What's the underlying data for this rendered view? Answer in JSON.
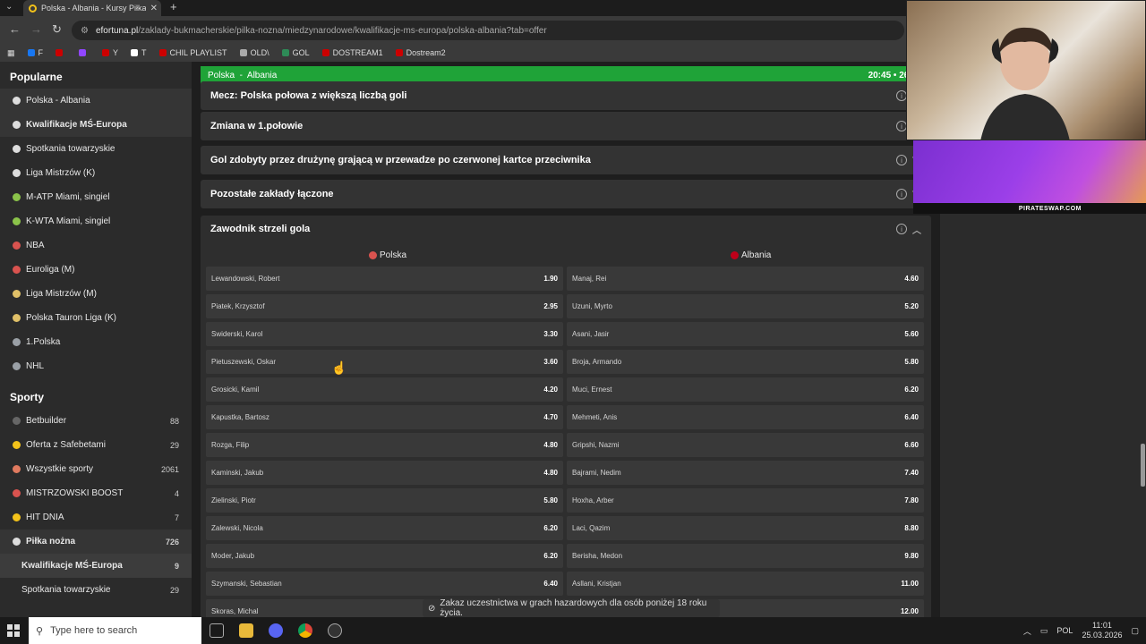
{
  "browser": {
    "tab_title": "Polska - Albania - Kursy Piłka n",
    "url_domain": "efortuna.pl",
    "url_path": "/zaklady-bukmacherskie/pilka-nozna/miedzynarodowe/kwalifikacje-ms-europa/polska-albania?tab=offer",
    "bookmarks": [
      {
        "label": "F",
        "color": "#1877f2"
      },
      {
        "label": "",
        "color": "#cc0000"
      },
      {
        "label": "",
        "color": "#9146ff"
      },
      {
        "label": "Y",
        "color": "#cc0000"
      },
      {
        "label": "T",
        "color": "#ffffff"
      },
      {
        "label": "CHIL PLAYLIST",
        "color": "#cc0000"
      },
      {
        "label": "OLD\\",
        "color": "#aaaaaa"
      },
      {
        "label": "GOL",
        "color": "#2e8b57"
      },
      {
        "label": "DOSTREAM1",
        "color": "#cc0000"
      },
      {
        "label": "Dostream2",
        "color": "#cc0000"
      }
    ]
  },
  "sidebar": {
    "popular_title": "Popularne",
    "popular": [
      {
        "label": "Polska - Albania",
        "icon": "soccer-ball-icon",
        "color": "#dddddd",
        "style": "hl"
      },
      {
        "label": "Kwalifikacje MŚ-Europa",
        "icon": "soccer-ball-icon",
        "color": "#dddddd",
        "style": "hlb"
      },
      {
        "label": "Spotkania towarzyskie",
        "icon": "soccer-ball-icon",
        "color": "#dddddd",
        "style": ""
      },
      {
        "label": "Liga Mistrzów (K)",
        "icon": "soccer-ball-icon",
        "color": "#dddddd",
        "style": ""
      },
      {
        "label": "M-ATP Miami, singiel",
        "icon": "tennis-ball-icon",
        "color": "#8bc34a",
        "style": ""
      },
      {
        "label": "K-WTA Miami, singiel",
        "icon": "tennis-ball-icon",
        "color": "#8bc34a",
        "style": ""
      },
      {
        "label": "NBA",
        "icon": "basketball-icon",
        "color": "#d9534f",
        "style": ""
      },
      {
        "label": "Euroliga (M)",
        "icon": "basketball-icon",
        "color": "#d9534f",
        "style": ""
      },
      {
        "label": "Liga Mistrzów (M)",
        "icon": "volleyball-icon",
        "color": "#e0c068",
        "style": ""
      },
      {
        "label": "Polska Tauron Liga (K)",
        "icon": "volleyball-icon",
        "color": "#e0c068",
        "style": ""
      },
      {
        "label": "1.Polska",
        "icon": "hockey-stick-icon",
        "color": "#9aa0a6",
        "style": ""
      },
      {
        "label": "NHL",
        "icon": "hockey-stick-icon",
        "color": "#9aa0a6",
        "style": ""
      }
    ],
    "sports_title": "Sporty",
    "sports": [
      {
        "label": "Betbuilder",
        "count": "88",
        "icon": "betbuilder-icon",
        "color": "#666666"
      },
      {
        "label": "Oferta z Safebetami",
        "count": "29",
        "icon": "safebet-icon",
        "color": "#f3c21a"
      },
      {
        "label": "Wszystkie sporty",
        "count": "2061",
        "icon": "all-sports-icon",
        "color": "#e07a5f"
      },
      {
        "label": "MISTRZOWSKI BOOST",
        "count": "4",
        "icon": "boost-icon",
        "color": "#d9534f"
      },
      {
        "label": "HIT DNIA",
        "count": "7",
        "icon": "hit-icon",
        "color": "#f3c21a"
      },
      {
        "label": "Piłka nożna",
        "count": "726",
        "icon": "soccer-ball-icon",
        "color": "#dddddd"
      }
    ],
    "subitems": [
      {
        "label": "Kwalifikacje MŚ-Europa",
        "count": "9",
        "active": true
      },
      {
        "label": "Spotkania towarzyskie",
        "count": "29",
        "active": false
      }
    ]
  },
  "match": {
    "header": "Polska  -  Albania",
    "time": "20:45  •  26.03."
  },
  "markets": [
    {
      "label": "Mecz: Polska połowa z większą liczbą goli"
    },
    {
      "label": "Zmiana w 1.połowie"
    },
    {
      "label": "Gol zdobyty przez drużynę grającą w przewadze po czerwonej kartce przeciwnika"
    },
    {
      "label": "Pozostałe zakłady łączone"
    }
  ],
  "scorer": {
    "title": "Zawodnik strzeli gola",
    "home_team": "Polska",
    "away_team": "Albania",
    "home": [
      {
        "name": "Lewandowski, Robert",
        "odd": "1.90"
      },
      {
        "name": "Piatek, Krzysztof",
        "odd": "2.95"
      },
      {
        "name": "Swiderski, Karol",
        "odd": "3.30"
      },
      {
        "name": "Pietuszewski, Oskar",
        "odd": "3.60"
      },
      {
        "name": "Grosicki, Kamil",
        "odd": "4.20"
      },
      {
        "name": "Kapustka, Bartosz",
        "odd": "4.70"
      },
      {
        "name": "Rozga, Filip",
        "odd": "4.80"
      },
      {
        "name": "Kaminski, Jakub",
        "odd": "4.80"
      },
      {
        "name": "Zielinski, Piotr",
        "odd": "5.80"
      },
      {
        "name": "Zalewski, Nicola",
        "odd": "6.20"
      },
      {
        "name": "Moder, Jakub",
        "odd": "6.20"
      },
      {
        "name": "Szymanski, Sebastian",
        "odd": "6.40"
      },
      {
        "name": "Skoras, Michal",
        "odd": ""
      }
    ],
    "away": [
      {
        "name": "Manaj, Rei",
        "odd": "4.60"
      },
      {
        "name": "Uzuni, Myrto",
        "odd": "5.20"
      },
      {
        "name": "Asani, Jasir",
        "odd": "5.60"
      },
      {
        "name": "Broja, Armando",
        "odd": "5.80"
      },
      {
        "name": "Muci, Ernest",
        "odd": "6.20"
      },
      {
        "name": "Mehmeti, Anis",
        "odd": "6.40"
      },
      {
        "name": "Gripshi, Nazmi",
        "odd": "6.60"
      },
      {
        "name": "Bajrami, Nedim",
        "odd": "7.40"
      },
      {
        "name": "Hoxha, Arber",
        "odd": "7.80"
      },
      {
        "name": "Laci, Qazim",
        "odd": "8.80"
      },
      {
        "name": "Berisha, Medon",
        "odd": "9.80"
      },
      {
        "name": "Asllani, Kristjan",
        "odd": "11.00"
      },
      {
        "name": "",
        "odd": "12.00"
      }
    ]
  },
  "disclaimer": "Zakaz uczestnictwa w grach hazardowych dla osób poniżej 18 roku życia.",
  "overlay": {
    "banner_text": "PIRATESWAP.COM"
  },
  "taskbar": {
    "search_placeholder": "Type here to search",
    "lang": "POL",
    "time": "11:01",
    "date": "25.03.2026"
  },
  "colors": {
    "accent_green": "#1fa338",
    "poland_flag": "#d9534f",
    "albania_flag": "#c0001a"
  }
}
